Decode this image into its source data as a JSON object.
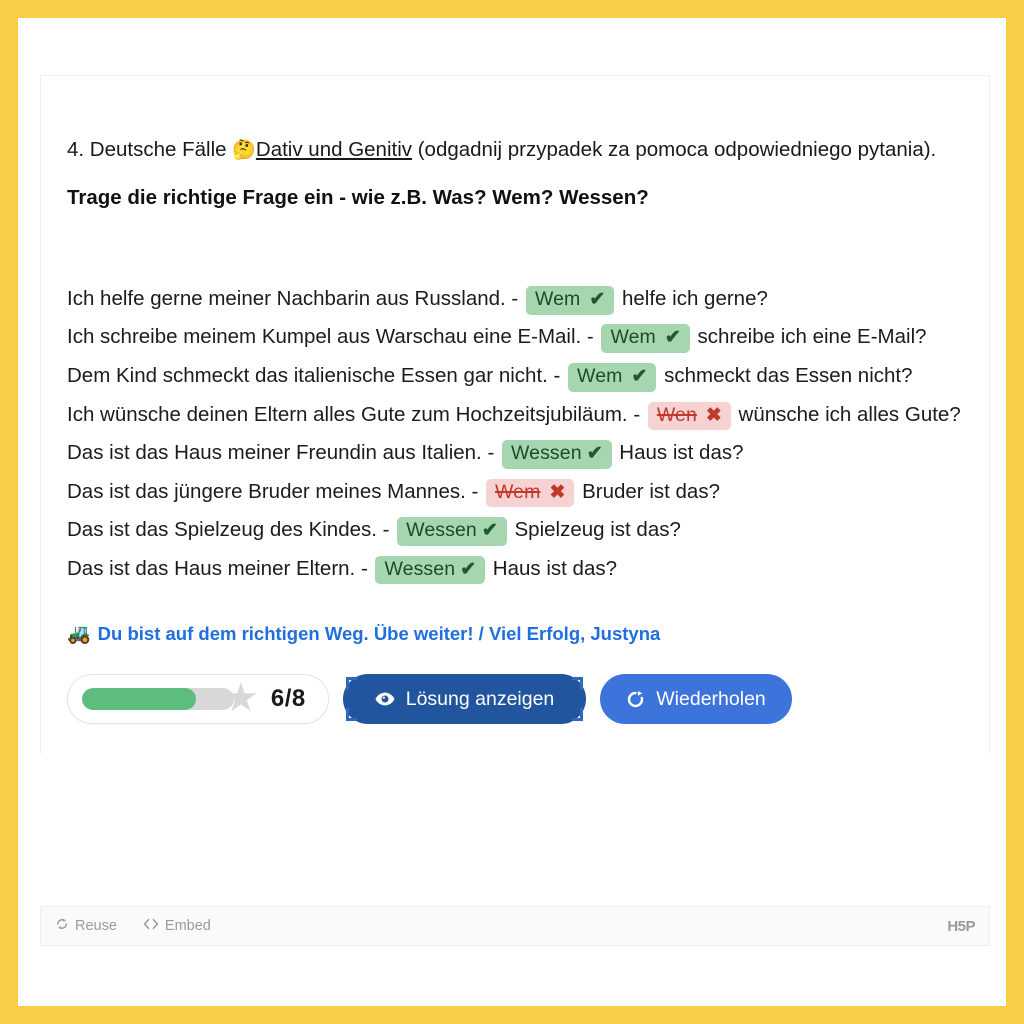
{
  "task": {
    "number_and_title_before": "4. Deutsche Fälle ",
    "thinking_emoji": "🤔",
    "underlined": "Dativ und Genitiv",
    "title_after": " (odgadnij przypadek za pomoca odpowiedniego pytania).",
    "instruction": "Trage die richtige Frage ein - wie z.B. Was? Wem? Wessen?"
  },
  "sentences": [
    {
      "before": "Ich helfe gerne meiner Nachbarin aus Russland. - ",
      "answer": "Wem",
      "status": "correct",
      "mark": "✔",
      "after": " helfe ich gerne?"
    },
    {
      "before": "Ich schreibe meinem Kumpel aus Warschau eine E-Mail. - ",
      "answer": "Wem",
      "status": "correct",
      "mark": "✔",
      "after": " schreibe ich eine E-Mail?"
    },
    {
      "before": "Dem Kind schmeckt das italienische Essen gar nicht. - ",
      "answer": "Wem",
      "status": "correct",
      "mark": "✔",
      "after": " schmeckt das Essen nicht?"
    },
    {
      "before": "Ich wünsche deinen Eltern alles Gute zum Hochzeitsjubiläum. - ",
      "answer": "Wen",
      "status": "wrong",
      "mark": "✖",
      "after": " wünsche ich alles Gute?"
    },
    {
      "before": "Das ist das Haus meiner Freundin aus Italien. - ",
      "answer": "Wessen",
      "status": "correct",
      "mark": "✔",
      "after": " Haus ist das?"
    },
    {
      "before": "Das ist das jüngere Bruder meines Mannes. - ",
      "answer": "Wem",
      "status": "wrong",
      "mark": "✖",
      "after": " Bruder ist das?"
    },
    {
      "before": "Das ist das Spielzeug des Kindes. - ",
      "answer": "Wessen",
      "status": "correct",
      "mark": "✔",
      "after": " Spielzeug ist das?"
    },
    {
      "before": "Das ist das Haus meiner Eltern. - ",
      "answer": "Wessen",
      "status": "correct",
      "mark": "✔",
      "after": " Haus ist das?"
    }
  ],
  "feedback": {
    "emoji": "🚜",
    "text": "Du bist auf dem richtigen Weg. Übe weiter! / Viel Erfolg, Justyna"
  },
  "actions": {
    "score_text": "6/8",
    "score_value": 6,
    "score_max": 8,
    "progress_percent": 75,
    "solution_label": "Lösung anzeigen",
    "retry_label": "Wiederholen"
  },
  "footer": {
    "reuse_label": "Reuse",
    "embed_label": "Embed",
    "logo": "H5P"
  },
  "colors": {
    "page_border": "#F8CE46",
    "correct_chip": "#a5d6b0",
    "wrong_chip": "#f6d2d2",
    "progress_fill": "#5cbd7e",
    "solution_button": "#21559D",
    "retry_button": "#3D74DB",
    "feedback_text": "#1f6fe0"
  }
}
